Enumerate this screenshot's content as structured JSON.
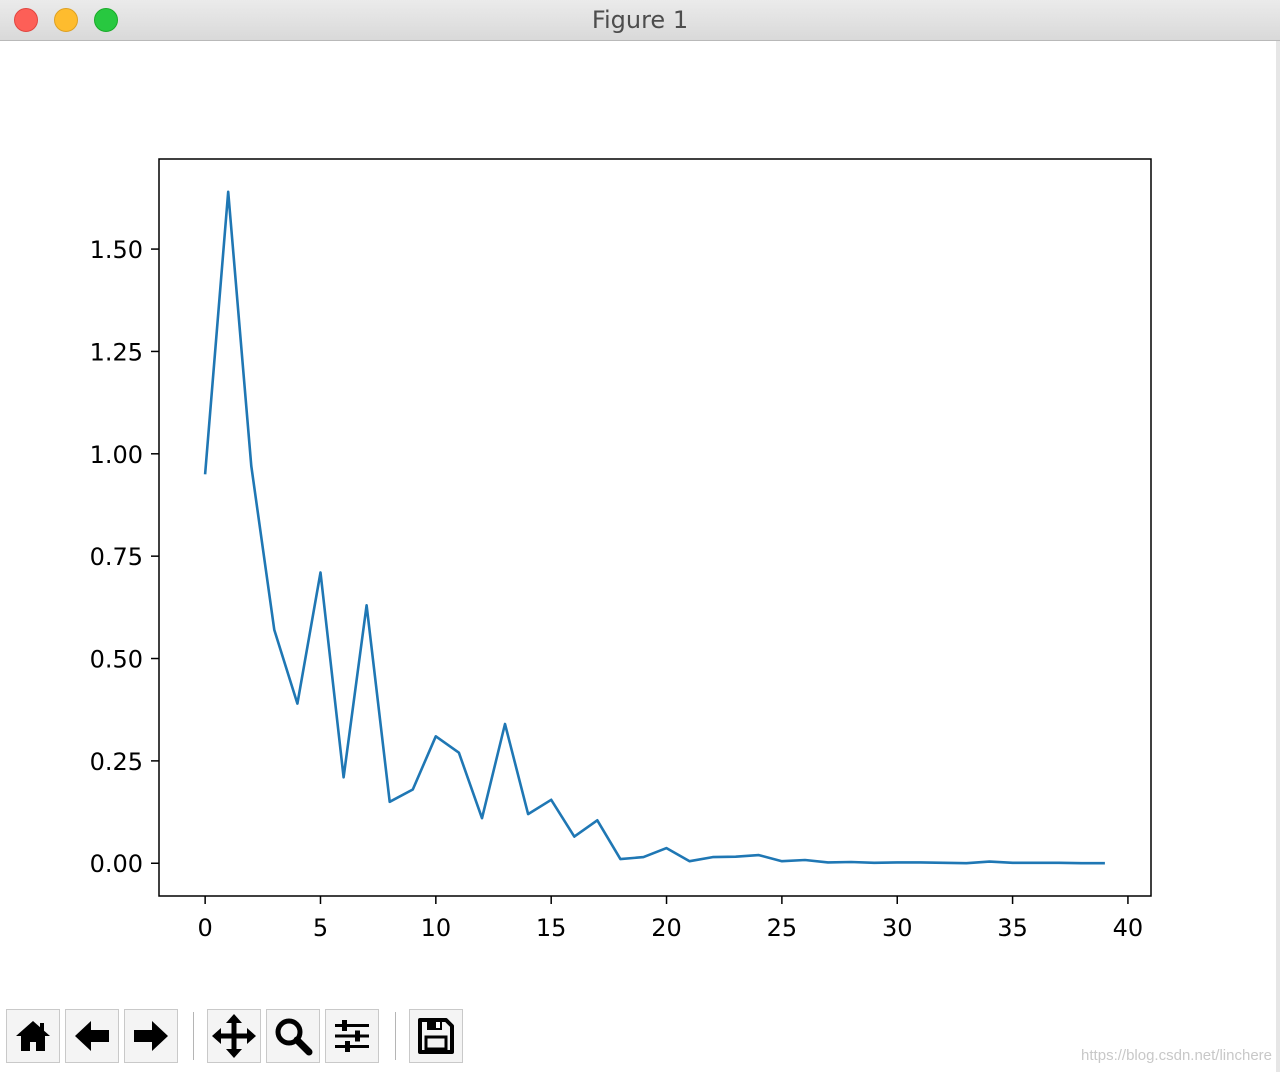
{
  "window": {
    "title": "Figure 1"
  },
  "toolbar": {
    "buttons": [
      {
        "name": "home",
        "icon": "home-icon"
      },
      {
        "name": "back",
        "icon": "arrow-left-icon"
      },
      {
        "name": "forward",
        "icon": "arrow-right-icon"
      },
      {
        "name": "pan",
        "icon": "move-icon"
      },
      {
        "name": "zoom",
        "icon": "magnifier-icon"
      },
      {
        "name": "configure",
        "icon": "sliders-icon"
      },
      {
        "name": "save",
        "icon": "floppy-disk-icon"
      }
    ]
  },
  "watermark": "https://blog.csdn.net/linchere",
  "chart_data": {
    "type": "line",
    "title": "",
    "xlabel": "",
    "ylabel": "",
    "xlim": [
      -2,
      41
    ],
    "ylim": [
      -0.08,
      1.72
    ],
    "xticks": [
      0,
      5,
      10,
      15,
      20,
      25,
      30,
      35,
      40
    ],
    "yticks": [
      0.0,
      0.25,
      0.5,
      0.75,
      1.0,
      1.25,
      1.5
    ],
    "xtick_labels": [
      "0",
      "5",
      "10",
      "15",
      "20",
      "25",
      "30",
      "35",
      "40"
    ],
    "ytick_labels": [
      "0.00",
      "0.25",
      "0.50",
      "0.75",
      "1.00",
      "1.25",
      "1.50"
    ],
    "grid": false,
    "line_color": "#1f77b4",
    "series": [
      {
        "x": [
          0,
          1,
          2,
          3,
          4,
          5,
          6,
          7,
          8,
          9,
          10,
          11,
          12,
          13,
          14,
          15,
          16,
          17,
          18,
          19,
          20,
          21,
          22,
          23,
          24,
          25,
          26,
          27,
          28,
          29,
          30,
          31,
          32,
          33,
          34,
          35,
          36,
          37,
          38,
          39
        ],
        "y": [
          0.95,
          1.64,
          0.97,
          0.57,
          0.39,
          0.71,
          0.21,
          0.63,
          0.15,
          0.18,
          0.31,
          0.27,
          0.11,
          0.34,
          0.12,
          0.155,
          0.065,
          0.105,
          0.01,
          0.015,
          0.037,
          0.005,
          0.015,
          0.016,
          0.02,
          0.005,
          0.008,
          0.002,
          0.003,
          0.001,
          0.002,
          0.002,
          0.001,
          0.0,
          0.004,
          0.001,
          0.001,
          0.001,
          0.0,
          0.0
        ]
      }
    ]
  }
}
